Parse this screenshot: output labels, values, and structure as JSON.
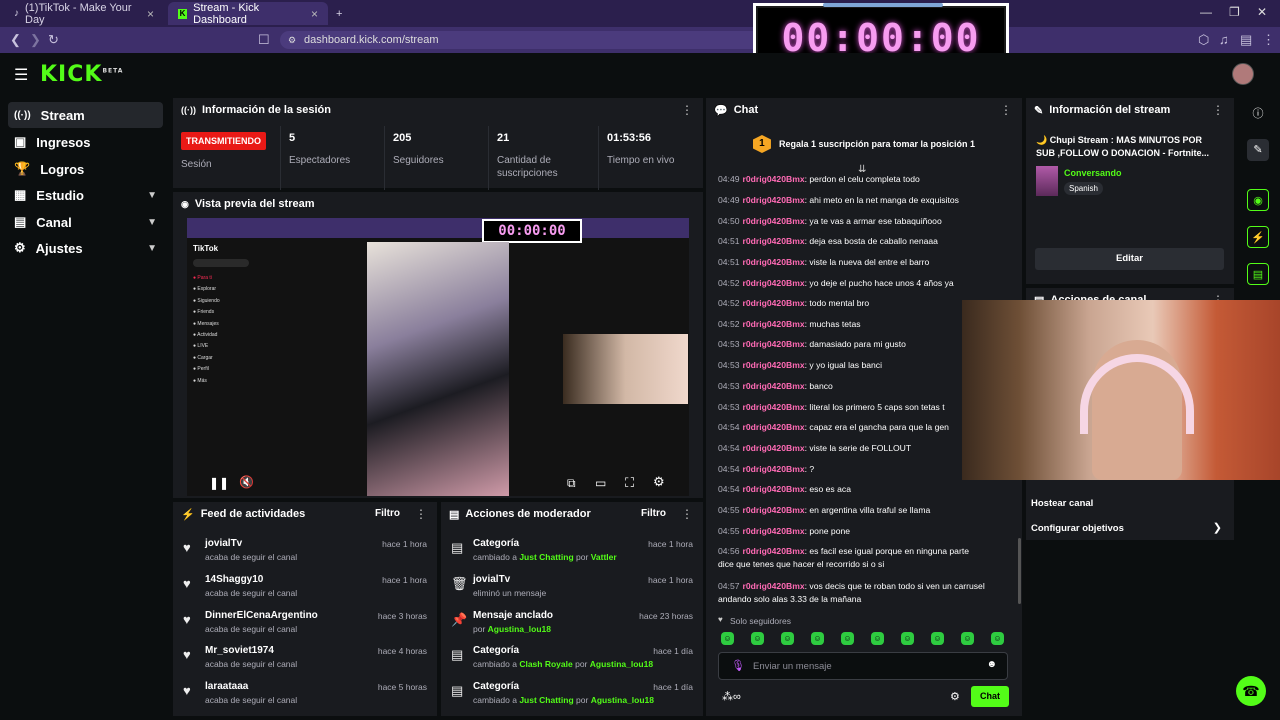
{
  "browser": {
    "tabs": [
      {
        "label": "(1)TikTok - Make Your Day",
        "active": false
      },
      {
        "label": "Stream - Kick Dashboard",
        "active": true
      }
    ],
    "url": "dashboard.kick.com/stream"
  },
  "timer_overlay": {
    "time": "00:00:00"
  },
  "app": {
    "logo": "KICK",
    "logo_sup": "BETA"
  },
  "sidebar": {
    "items": [
      {
        "label": "Stream",
        "icon": "broadcast-icon",
        "active": true
      },
      {
        "label": "Ingresos",
        "icon": "money-icon"
      },
      {
        "label": "Logros",
        "icon": "trophy-icon"
      },
      {
        "label": "Estudio",
        "icon": "studio-icon",
        "expandable": true
      },
      {
        "label": "Canal",
        "icon": "channel-icon",
        "expandable": true
      },
      {
        "label": "Ajustes",
        "icon": "gear-icon",
        "expandable": true
      }
    ]
  },
  "session": {
    "title": "Información de la sesión",
    "status": "TRANSMITIENDO",
    "status_label": "Sesión",
    "stats": [
      {
        "value": "5",
        "label": "Espectadores"
      },
      {
        "value": "205",
        "label": "Seguidores"
      },
      {
        "value": "21",
        "label": "Cantidad de suscripciones"
      },
      {
        "value": "01:53:56",
        "label": "Tiempo en vivo"
      }
    ]
  },
  "preview": {
    "title": "Vista previa del stream",
    "inner_timer": "00:00:00",
    "tiktok_logo": "TikTok",
    "tiktok_menu": [
      "Para ti",
      "Explorar",
      "Siguiendo",
      "Friends",
      "Mensajes",
      "Actividad",
      "LIVE",
      "Cargar",
      "Perfil",
      "Más"
    ]
  },
  "activity": {
    "title": "Feed de actividades",
    "filter": "Filtro",
    "rows": [
      {
        "name": "jovialTv",
        "sub": "acaba de seguir el canal",
        "time": "hace 1 hora"
      },
      {
        "name": "14Shaggy10",
        "sub": "acaba de seguir el canal",
        "time": "hace 1 hora"
      },
      {
        "name": "DinnerElCenaArgentino",
        "sub": "acaba de seguir el canal",
        "time": "hace 3 horas"
      },
      {
        "name": "Mr_soviet1974",
        "sub": "acaba de seguir el canal",
        "time": "hace 4 horas"
      },
      {
        "name": "laraataaa",
        "sub": "acaba de seguir el canal",
        "time": "hace 5 horas"
      }
    ]
  },
  "moderator": {
    "title": "Acciones de moderador",
    "filter": "Filtro",
    "rows": [
      {
        "title": "Categoría",
        "pre": "cambiado a",
        "target": "Just Chatting",
        "mid": "por",
        "by": "Vattler",
        "time": "hace 1 hora",
        "icon": "category-icon"
      },
      {
        "title": "jovialTv",
        "pre": "eliminó un mensaje",
        "target": "",
        "mid": "",
        "by": "",
        "time": "hace 1 hora",
        "icon": "trash-icon"
      },
      {
        "title": "Mensaje anclado",
        "pre": "por",
        "target": "Agustina_lou18",
        "mid": "",
        "by": "",
        "time": "hace 23 horas",
        "icon": "pin-icon"
      },
      {
        "title": "Categoría",
        "pre": "cambiado a",
        "target": "Clash Royale",
        "mid": "por",
        "by": "Agustina_lou18",
        "time": "hace 1 día",
        "icon": "category-icon"
      },
      {
        "title": "Categoría",
        "pre": "cambiado a",
        "target": "Just Chatting",
        "mid": "por",
        "by": "Agustina_lou18",
        "time": "hace 1 día",
        "icon": "category-icon"
      }
    ]
  },
  "chat": {
    "title": "Chat",
    "sub_banner": "Regala 1 suscripción para tomar la posición 1",
    "sub_rank": "1",
    "messages": [
      {
        "t": "04:49",
        "u": "r0drig0420Bmx",
        "m": "perdon el celu completa todo"
      },
      {
        "t": "04:49",
        "u": "r0drig0420Bmx",
        "m": "ahi meto en la net manga de exquisitos"
      },
      {
        "t": "04:50",
        "u": "r0drig0420Bmx",
        "m": "ya te vas a armar ese tabaquiñooo"
      },
      {
        "t": "04:51",
        "u": "r0drig0420Bmx",
        "m": "deja esa bosta de caballo nenaaa"
      },
      {
        "t": "04:51",
        "u": "r0drig0420Bmx",
        "m": "viste la nueva del entre el barro"
      },
      {
        "t": "04:52",
        "u": "r0drig0420Bmx",
        "m": "yo deje el pucho hace unos 4 años ya"
      },
      {
        "t": "04:52",
        "u": "r0drig0420Bmx",
        "m": "todo mental bro"
      },
      {
        "t": "04:52",
        "u": "r0drig0420Bmx",
        "m": "muchas tetas"
      },
      {
        "t": "04:53",
        "u": "r0drig0420Bmx",
        "m": "damasiado para mi gusto"
      },
      {
        "t": "04:53",
        "u": "r0drig0420Bmx",
        "m": "y yo igual las banci"
      },
      {
        "t": "04:53",
        "u": "r0drig0420Bmx",
        "m": "banco"
      },
      {
        "t": "04:53",
        "u": "r0drig0420Bmx",
        "m": "literal los primero 5 caps son tetas t"
      },
      {
        "t": "04:54",
        "u": "r0drig0420Bmx",
        "m": "capaz era el gancha para que la gen"
      },
      {
        "t": "04:54",
        "u": "r0drig0420Bmx",
        "m": "viste la serie de FOLLOUT"
      },
      {
        "t": "04:54",
        "u": "r0drig0420Bmx",
        "m": "?"
      },
      {
        "t": "04:54",
        "u": "r0drig0420Bmx",
        "m": "eso es aca"
      },
      {
        "t": "04:55",
        "u": "r0drig0420Bmx",
        "m": "en argentina villa traful se llama"
      },
      {
        "t": "04:55",
        "u": "r0drig0420Bmx",
        "m": "pone pone"
      },
      {
        "t": "04:56",
        "u": "r0drig0420Bmx",
        "m": "es facil ese igual porque en ninguna parte"
      },
      {
        "t": "",
        "u": "",
        "m": "dice que tenes que hacer el recorrido si o si"
      },
      {
        "t": "04:57",
        "u": "r0drig0420Bmx",
        "m": "vos decis que te roban todo si ven un carrusel"
      },
      {
        "t": "",
        "u": "",
        "m": "andando solo alas 3.33 de la mañana"
      }
    ],
    "followers_only": "Solo seguidores",
    "input_placeholder": "Enviar un mensaje",
    "send_label": "Chat"
  },
  "stream_info": {
    "title": "Información del stream",
    "stream_title": "🌙 Chupi Stream : MAS MINUTOS POR SUB ,FOLLOW O DONACION - Fortnite...",
    "category": "Conversando",
    "language": "Spanish",
    "edit_label": "Editar"
  },
  "channel_actions": {
    "title": "Acciones de canal",
    "items": [
      "Hostear canal",
      "Configurar objetivos"
    ]
  },
  "colors": {
    "accent": "#53fc18",
    "live": "#e91916",
    "username": "#ff6bb5"
  }
}
